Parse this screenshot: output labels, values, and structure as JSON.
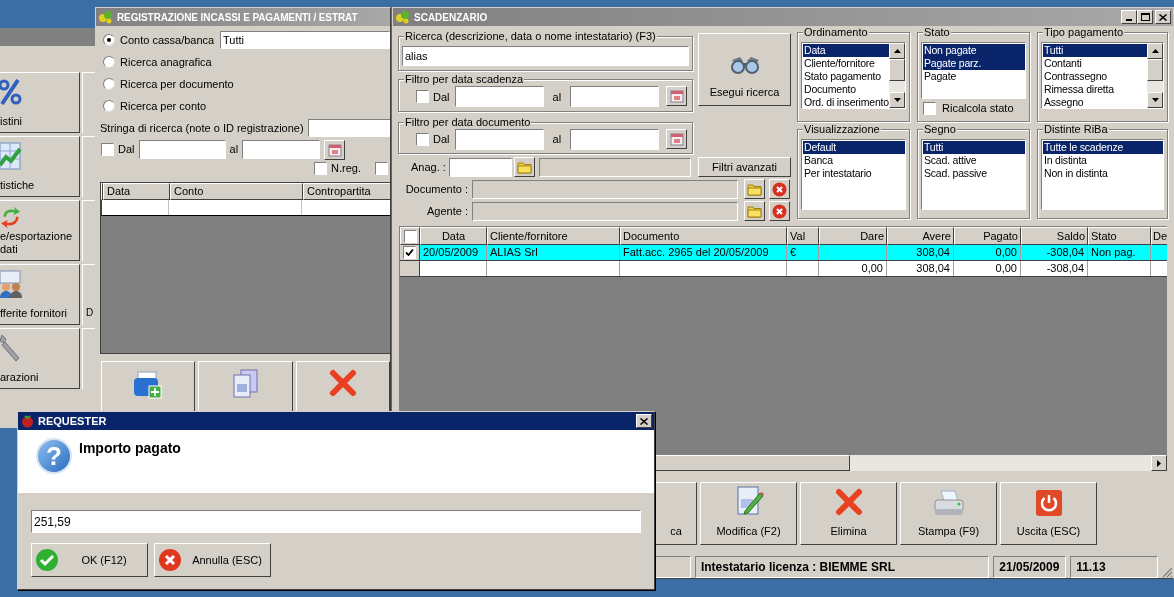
{
  "main_window": {
    "tiles": [
      {
        "label": "istini"
      },
      {
        "label": "tistiche"
      },
      {
        "label": "e/esportazione dati"
      },
      {
        "label": "fferite fornitori"
      },
      {
        "label": "arazioni"
      }
    ],
    "column_2_label": "D"
  },
  "registration_window": {
    "title": "REGISTRAZIONE INCASSI E PAGAMENTI / ESTRAT",
    "search_modes": [
      {
        "label": "Conto cassa/banca",
        "selected": true
      },
      {
        "label": "Ricerca anagrafica",
        "selected": false
      },
      {
        "label": "Ricerca per documento",
        "selected": false
      },
      {
        "label": "Ricerca per conto",
        "selected": false
      }
    ],
    "account_field": {
      "value": "Tutti"
    },
    "search_string": {
      "label": "Stringa di ricerca (note o ID registrazione)"
    },
    "date_filter": {
      "checked": false,
      "from_label": "Dal",
      "to_label": "al"
    },
    "nreg": {
      "label": "N.reg.",
      "checked": false
    },
    "extra_checkbox": {
      "checked": false
    },
    "table": {
      "columns": [
        "Data",
        "Conto",
        "Contropartita"
      ]
    }
  },
  "scadenzario": {
    "title": "SCADENZARIO",
    "search": {
      "legend": "Ricerca (descrizione, data o nome intestatario) (F3)",
      "value": "alias"
    },
    "search_button": "Esegui ricerca",
    "date_filters": [
      {
        "legend": "Filtro per data scadenza",
        "checked": false,
        "from_label": "Dal",
        "to_label": "al"
      },
      {
        "legend": "Filtro per data documento",
        "checked": false,
        "from_label": "Dal",
        "to_label": "al"
      }
    ],
    "anag_label": "Anag. :",
    "advanced_filters_button": "Filtri avanzati",
    "document_label": "Documento :",
    "agent_label": "Agente :",
    "lists": [
      {
        "legend": "Ordinamento",
        "scrollbar": true,
        "items": [
          {
            "label": "Data",
            "selected": true
          },
          {
            "label": "Cliente/fornitore",
            "selected": false
          },
          {
            "label": "Stato pagamento",
            "selected": false
          },
          {
            "label": "Documento",
            "selected": false
          },
          {
            "label": "Ord. di inserimento",
            "selected": false
          }
        ]
      },
      {
        "legend": "Stato",
        "scrollbar": false,
        "items": [
          {
            "label": "Non pagate",
            "selected": true
          },
          {
            "label": "Pagate parz.",
            "selected": true
          },
          {
            "label": "Pagate",
            "selected": false
          }
        ]
      },
      {
        "legend": "Tipo pagamento",
        "scrollbar": true,
        "items": [
          {
            "label": "Tutti",
            "selected": true
          },
          {
            "label": "Contanti",
            "selected": false
          },
          {
            "label": "Contrassegno",
            "selected": false
          },
          {
            "label": "Rimessa diretta",
            "selected": false
          },
          {
            "label": "Assegno",
            "selected": false
          }
        ]
      },
      {
        "legend": "Visualizzazione",
        "scrollbar": false,
        "items": [
          {
            "label": "Default",
            "selected": true
          },
          {
            "label": "Banca",
            "selected": false
          },
          {
            "label": "Per intestatario",
            "selected": false
          }
        ]
      },
      {
        "legend": "Segno",
        "scrollbar": false,
        "items": [
          {
            "label": "Tutti",
            "selected": true
          },
          {
            "label": "Scad. attive",
            "selected": false
          },
          {
            "label": "Scad. passive",
            "selected": false
          }
        ]
      },
      {
        "legend": "Distinte RiBa",
        "scrollbar": false,
        "items": [
          {
            "label": "Tutte le scadenze",
            "selected": true
          },
          {
            "label": "In distinta",
            "selected": false
          },
          {
            "label": "Non in distinta",
            "selected": false
          }
        ]
      }
    ],
    "recalc": {
      "label": "Ricalcola stato",
      "checked": false
    },
    "table": {
      "columns": [
        {
          "kind": "check",
          "checked": false
        },
        {
          "kind": "date",
          "label": "Data"
        },
        {
          "kind": "text",
          "label": "Cliente/fornitore"
        },
        {
          "kind": "text",
          "label": "Documento"
        },
        {
          "kind": "text",
          "label": "Val"
        },
        {
          "kind": "number",
          "label": "Dare"
        },
        {
          "kind": "number",
          "label": "Avere"
        },
        {
          "kind": "number",
          "label": "Pagato"
        },
        {
          "kind": "number",
          "label": "Saldo"
        },
        {
          "kind": "text",
          "label": "Stato"
        },
        {
          "kind": "text",
          "label": "De"
        }
      ],
      "rows": [
        {
          "kind": "item",
          "checked": true,
          "highlighted": true,
          "cells": [
            null,
            "20/05/2009",
            "ALIAS Srl",
            "Fatt.acc. 2965 del 20/05/2009",
            "€",
            null,
            "308,04",
            "0,00",
            "-308,04",
            "Non pag.",
            null
          ]
        },
        {
          "kind": "total",
          "highlighted": false,
          "cells": [
            null,
            null,
            null,
            null,
            null,
            "0,00",
            "308,04",
            "0,00",
            "-308,04",
            null,
            null
          ]
        }
      ]
    },
    "buttons": [
      {
        "label": "ca"
      },
      {
        "label": "Modifica (F2)"
      },
      {
        "label": "Elimina"
      },
      {
        "label": "Stampa (F9)"
      },
      {
        "label": "Uscita (ESC)"
      }
    ],
    "status_bar": [
      "Intestatario licenza : BIEMME SRL",
      "21/05/2009",
      "11.13"
    ]
  },
  "requester": {
    "title": "REQUESTER",
    "icon_text": "?",
    "prompt": "Importo pagato",
    "value": "251,59",
    "buttons": [
      {
        "label": "OK (F12)",
        "kind": "ok"
      },
      {
        "label": "Annulla (ESC)",
        "kind": "cancel"
      }
    ]
  }
}
